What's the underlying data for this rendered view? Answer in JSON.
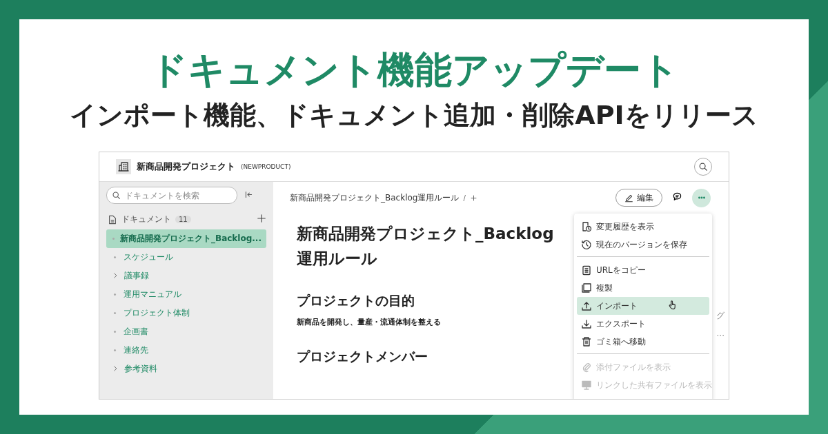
{
  "banner": {
    "title": "ドキュメント機能アップデート",
    "subtitle": "インポート機能、ドキュメント追加・削除APIをリリース"
  },
  "header": {
    "project_name": "新商品開発プロジェクト",
    "project_key": "(NEWPRODUCT)"
  },
  "sidebar": {
    "search": {
      "placeholder": "ドキュメントを検索"
    },
    "section": {
      "label": "ドキュメント",
      "count": "11"
    },
    "items": [
      {
        "label": "新商品開発プロジェクト_Backlog...",
        "kind": "leaf",
        "selected": true
      },
      {
        "label": "スケジュール",
        "kind": "leaf",
        "selected": false
      },
      {
        "label": "議事録",
        "kind": "folder",
        "selected": false
      },
      {
        "label": "運用マニュアル",
        "kind": "leaf",
        "selected": false
      },
      {
        "label": "プロジェクト体制",
        "kind": "leaf",
        "selected": false
      },
      {
        "label": "企画書",
        "kind": "leaf",
        "selected": false
      },
      {
        "label": "連絡先",
        "kind": "leaf",
        "selected": false
      },
      {
        "label": "参考資料",
        "kind": "folder",
        "selected": false
      }
    ]
  },
  "breadcrumb": {
    "path": "新商品開発プロジェクト_Backlog運用ルール",
    "separator": "/"
  },
  "toolbar": {
    "edit_label": "編集"
  },
  "document": {
    "title": "新商品開発プロジェクト_Backlog運用ルール",
    "blocks": [
      {
        "kind": "h2",
        "text": "プロジェクトの目的"
      },
      {
        "kind": "p",
        "text": "新商品を開発し、量産・流通体制を整える"
      },
      {
        "kind": "h2",
        "text": "プロジェクトメンバー"
      }
    ]
  },
  "behind_menu": [
    "グ",
    "..."
  ],
  "menu": {
    "groups": [
      [
        {
          "label": "変更履歴を表示",
          "highlighted": false,
          "disabled": false
        },
        {
          "label": "現在のバージョンを保存",
          "highlighted": false,
          "disabled": false
        }
      ],
      [
        {
          "label": "URLをコピー",
          "highlighted": false,
          "disabled": false
        },
        {
          "label": "複製",
          "highlighted": false,
          "disabled": false
        },
        {
          "label": "インポート",
          "highlighted": true,
          "disabled": false
        },
        {
          "label": "エクスポート",
          "highlighted": false,
          "disabled": false
        },
        {
          "label": "ゴミ箱へ移動",
          "highlighted": false,
          "disabled": false
        }
      ],
      [
        {
          "label": "添付ファイルを表示",
          "highlighted": false,
          "disabled": true
        },
        {
          "label": "リンクした共有ファイルを表示",
          "highlighted": false,
          "disabled": true
        }
      ]
    ]
  }
}
